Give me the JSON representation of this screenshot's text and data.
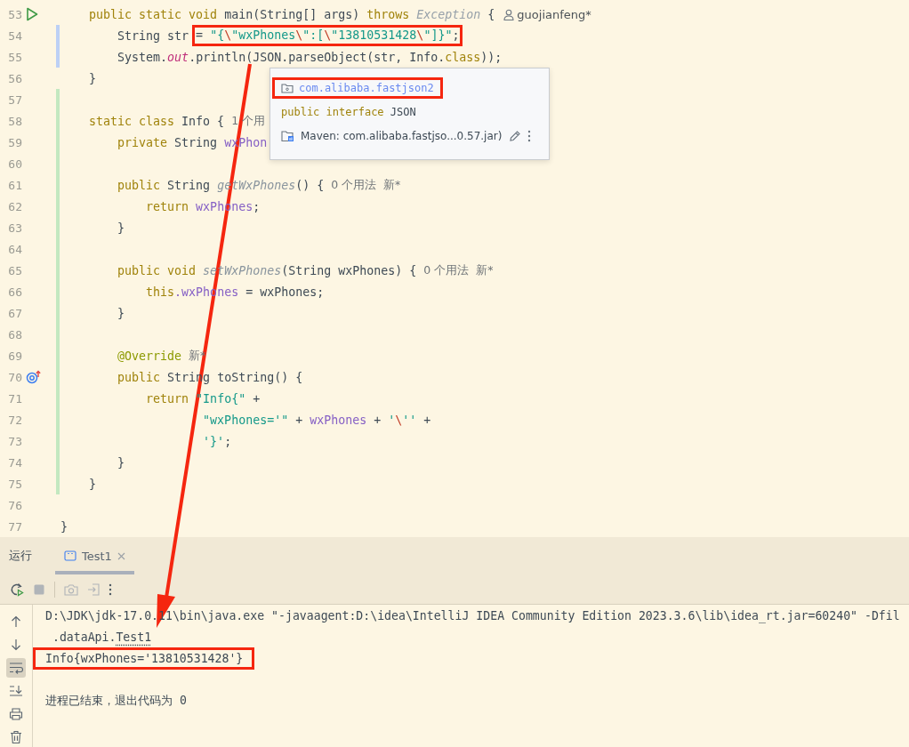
{
  "editor": {
    "lines": [
      {
        "number": "53",
        "marker": {
          "kind": "run"
        },
        "modified": false,
        "added": false,
        "tokens": [
          {
            "kind": "kw",
            "text": "    public static void "
          },
          {
            "kind": "plain",
            "text": "main(String[] args) "
          },
          {
            "kind": "kw",
            "text": "throws "
          },
          {
            "kind": "type",
            "text": "Exception"
          },
          {
            "kind": "plain",
            "text": " {"
          }
        ],
        "author": "guojianfeng*"
      },
      {
        "number": "54",
        "modified": true,
        "added": false,
        "tokens": [
          {
            "kind": "plain",
            "text": "        String str "
          }
        ],
        "boxed_tokens": [
          {
            "kind": "plain",
            "text": "= "
          },
          {
            "kind": "str",
            "text": "\"{"
          },
          {
            "kind": "esc",
            "text": "\\"
          },
          {
            "kind": "str",
            "text": "\"wxPhones"
          },
          {
            "kind": "esc",
            "text": "\\"
          },
          {
            "kind": "str",
            "text": "\":["
          },
          {
            "kind": "esc",
            "text": "\\"
          },
          {
            "kind": "str",
            "text": "\"13810531428"
          },
          {
            "kind": "esc",
            "text": "\\"
          },
          {
            "kind": "str",
            "text": "\"]}\""
          },
          {
            "kind": "plain",
            "text": ";"
          }
        ]
      },
      {
        "number": "55",
        "modified": true,
        "added": false,
        "tokens": [
          {
            "kind": "plain",
            "text": "        System."
          },
          {
            "kind": "static",
            "text": "out"
          },
          {
            "kind": "plain",
            "text": ".println(JSON.parseObject(str, Info."
          },
          {
            "kind": "kw",
            "text": "class"
          },
          {
            "kind": "plain",
            "text": "));"
          }
        ]
      },
      {
        "number": "56",
        "modified": false,
        "added": false,
        "tokens": [
          {
            "kind": "plain",
            "text": "    }"
          }
        ]
      },
      {
        "number": "57",
        "modified": false,
        "added": true
      },
      {
        "number": "58",
        "modified": false,
        "added": true,
        "tokens": [
          {
            "kind": "kw",
            "text": "    static class "
          },
          {
            "kind": "plain",
            "text": "Info {"
          }
        ],
        "hint": "1 个用"
      },
      {
        "number": "59",
        "modified": false,
        "added": true,
        "tokens": [
          {
            "kind": "kw",
            "text": "        private "
          },
          {
            "kind": "plain",
            "text": "String "
          },
          {
            "kind": "field",
            "text": "wxPhon"
          }
        ]
      },
      {
        "number": "60",
        "modified": false,
        "added": true
      },
      {
        "number": "61",
        "modified": false,
        "added": true,
        "tokens": [
          {
            "kind": "kw",
            "text": "        public "
          },
          {
            "kind": "plain",
            "text": "String "
          },
          {
            "kind": "method",
            "text": "getWxPhones"
          },
          {
            "kind": "plain",
            "text": "() {"
          }
        ],
        "hint": "0 个用法  新*"
      },
      {
        "number": "62",
        "modified": false,
        "added": true,
        "tokens": [
          {
            "kind": "kw",
            "text": "            return "
          },
          {
            "kind": "field",
            "text": "wxPhones"
          },
          {
            "kind": "plain",
            "text": ";"
          }
        ]
      },
      {
        "number": "63",
        "modified": false,
        "added": true,
        "tokens": [
          {
            "kind": "plain",
            "text": "        }"
          }
        ]
      },
      {
        "number": "64",
        "modified": false,
        "added": true
      },
      {
        "number": "65",
        "modified": false,
        "added": true,
        "tokens": [
          {
            "kind": "kw",
            "text": "        public void "
          },
          {
            "kind": "method",
            "text": "setWxPhones"
          },
          {
            "kind": "plain",
            "text": "(String wxPhones) {"
          }
        ],
        "hint": "0 个用法  新*"
      },
      {
        "number": "66",
        "modified": false,
        "added": true,
        "tokens": [
          {
            "kind": "kw",
            "text": "            this"
          },
          {
            "kind": "field",
            "text": ".wxPhones"
          },
          {
            "kind": "plain",
            "text": " = wxPhones;"
          }
        ]
      },
      {
        "number": "67",
        "modified": false,
        "added": true,
        "tokens": [
          {
            "kind": "plain",
            "text": "        }"
          }
        ]
      },
      {
        "number": "68",
        "modified": false,
        "added": true
      },
      {
        "number": "69",
        "modified": false,
        "added": true,
        "tokens": [
          {
            "kind": "annot",
            "text": "        @Override"
          }
        ],
        "hint": "新*"
      },
      {
        "number": "70",
        "marker": {
          "kind": "override"
        },
        "modified": false,
        "added": true,
        "tokens": [
          {
            "kind": "kw",
            "text": "        public "
          },
          {
            "kind": "plain",
            "text": "String toString() {"
          }
        ]
      },
      {
        "number": "71",
        "modified": false,
        "added": true,
        "tokens": [
          {
            "kind": "kw",
            "text": "            return "
          },
          {
            "kind": "str",
            "text": "\"Info{\""
          },
          {
            "kind": "plain",
            "text": " +"
          }
        ]
      },
      {
        "number": "72",
        "modified": false,
        "added": true,
        "tokens": [
          {
            "kind": "str",
            "text": "                    \"wxPhones='\""
          },
          {
            "kind": "plain",
            "text": " + "
          },
          {
            "kind": "field",
            "text": "wxPhones"
          },
          {
            "kind": "plain",
            "text": " + "
          },
          {
            "kind": "str",
            "text": "'"
          },
          {
            "kind": "esc",
            "text": "\\"
          },
          {
            "kind": "str",
            "text": "''"
          },
          {
            "kind": "plain",
            "text": " +"
          }
        ]
      },
      {
        "number": "73",
        "modified": false,
        "added": true,
        "tokens": [
          {
            "kind": "str",
            "text": "                    '}'"
          },
          {
            "kind": "plain",
            "text": ";"
          }
        ]
      },
      {
        "number": "74",
        "modified": false,
        "added": true,
        "tokens": [
          {
            "kind": "plain",
            "text": "        }"
          }
        ]
      },
      {
        "number": "75",
        "modified": false,
        "added": true,
        "tokens": [
          {
            "kind": "plain",
            "text": "    }"
          }
        ]
      },
      {
        "number": "76",
        "modified": false,
        "added": false
      },
      {
        "number": "77",
        "modified": false,
        "added": false,
        "tokens": [
          {
            "kind": "plain",
            "text": "}"
          }
        ]
      }
    ]
  },
  "popup": {
    "package": "com.alibaba.fastjson2",
    "declaration": [
      {
        "kind": "kw",
        "text": "public interface "
      },
      {
        "kind": "plain",
        "text": "JSON"
      }
    ],
    "library": "Maven: com.alibaba.fastjso...0.57.jar)"
  },
  "run_panel": {
    "title": "运行",
    "tabs": [
      {
        "label": "Test1",
        "selected": true
      }
    ],
    "actions": [
      {
        "kind": "rerun",
        "disabled": false
      },
      {
        "kind": "stop",
        "disabled": true
      },
      {
        "kind": "separator"
      },
      {
        "kind": "screenshot",
        "disabled": true
      },
      {
        "kind": "exit",
        "disabled": true
      },
      {
        "kind": "more",
        "disabled": false
      }
    ],
    "side_tools": [
      {
        "kind": "up",
        "selected": false
      },
      {
        "kind": "down",
        "selected": false
      },
      {
        "kind": "wrap",
        "selected": true
      },
      {
        "kind": "scroll-end",
        "selected": false
      },
      {
        "kind": "print",
        "selected": false
      },
      {
        "kind": "trash",
        "selected": false
      }
    ],
    "console": [
      {
        "kind": "command",
        "text": "D:\\JDK\\jdk-17.0.11\\bin\\java.exe \"-javaagent:D:\\idea\\IntelliJ IDEA Community Edition 2023.3.6\\lib\\idea_rt.jar=60240\" -Dfil"
      },
      {
        "kind": "class",
        "text": " .dataApi.",
        "link": "Test1"
      },
      {
        "kind": "output",
        "text": "Info{wxPhones='13810531428'}"
      },
      {
        "kind": "exit",
        "text": "进程已结束，退出代码为 0"
      }
    ]
  }
}
